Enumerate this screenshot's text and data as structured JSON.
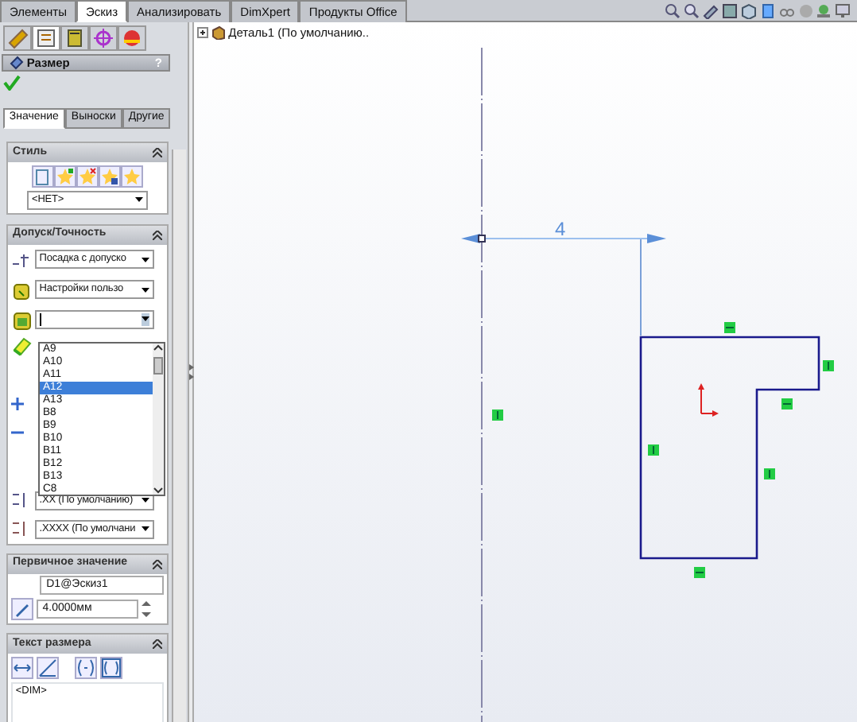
{
  "command_tabs": [
    {
      "label": "Элементы",
      "selected": false
    },
    {
      "label": "Эскиз",
      "selected": true
    },
    {
      "label": "Анализировать",
      "selected": false
    },
    {
      "label": "DimXpert",
      "selected": false
    },
    {
      "label": "Продукты Office",
      "selected": false
    }
  ],
  "feature_tree": {
    "label": "Деталь1 (По умолчанию..",
    "expanded": false
  },
  "panel": {
    "icon_tabs": [
      {
        "selected": false
      },
      {
        "selected": true
      },
      {
        "selected": false
      },
      {
        "selected": false
      },
      {
        "selected": false
      }
    ],
    "title": "Размер",
    "help": "?",
    "tabs": [
      {
        "label": "Значение",
        "selected": true
      },
      {
        "label": "Выноски",
        "selected": false
      },
      {
        "label": "Другие",
        "selected": false
      }
    ],
    "style": {
      "title": "Стиль",
      "select": "<НЕТ>"
    },
    "tolerance": {
      "title": "Допуск/Точность",
      "tolerance_type": "Посадка с допуско",
      "classification": "Настройки пользо",
      "fit_list": [
        {
          "label": "A9",
          "selected": false
        },
        {
          "label": "A10",
          "selected": false
        },
        {
          "label": "A11",
          "selected": false
        },
        {
          "label": "A12",
          "selected": true
        },
        {
          "label": "A13",
          "selected": false
        },
        {
          "label": "B8",
          "selected": false
        },
        {
          "label": "B9",
          "selected": false
        },
        {
          "label": "B10",
          "selected": false
        },
        {
          "label": "B11",
          "selected": false
        },
        {
          "label": "B12",
          "selected": false
        },
        {
          "label": "B13",
          "selected": false
        },
        {
          "label": "C8",
          "selected": false
        }
      ],
      "primary_precision": ".XX (По умолчанию)",
      "tolerance_precision": ".XXXX (По умолчани"
    },
    "primary_value": {
      "title": "Первичное значение",
      "name": "D1@Эскиз1",
      "value": "4.0000мм"
    },
    "dimension_text": {
      "title": "Текст размера",
      "text": "<DIM>"
    }
  },
  "sketch": {
    "dimension": "4"
  }
}
